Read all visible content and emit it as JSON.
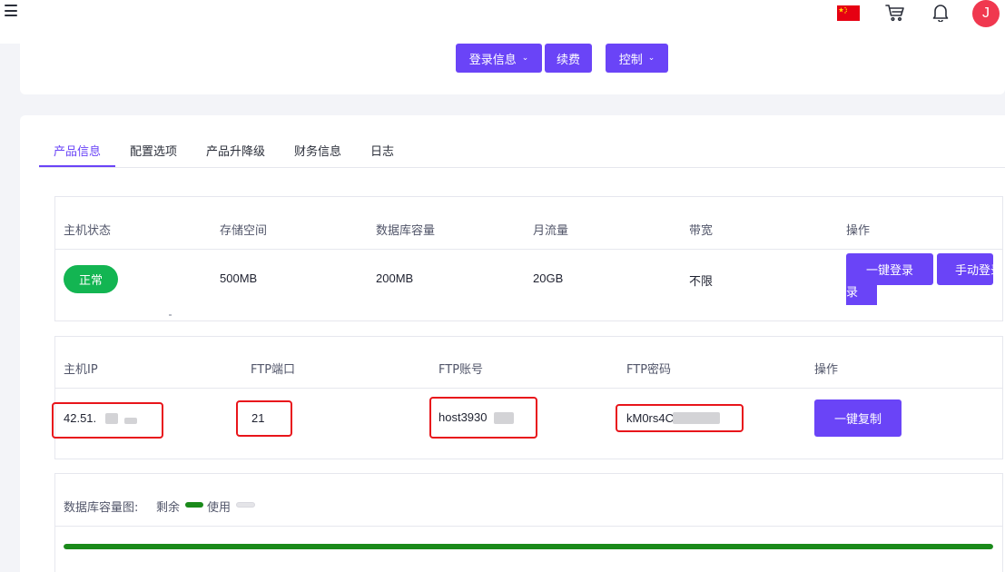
{
  "header": {
    "avatar_letter": "J",
    "icons": [
      "menu-icon",
      "china-flag-icon",
      "cart-icon",
      "bell-icon"
    ]
  },
  "actions": {
    "login_info": "登录信息",
    "renew": "续费",
    "control": "控制"
  },
  "tabs": [
    {
      "label": "产品信息",
      "active": true
    },
    {
      "label": "配置选项",
      "active": false
    },
    {
      "label": "产品升降级",
      "active": false
    },
    {
      "label": "财务信息",
      "active": false
    },
    {
      "label": "日志",
      "active": false
    }
  ],
  "host_table": {
    "headers": [
      "主机状态",
      "存储空间",
      "数据库容量",
      "月流量",
      "带宽",
      "操作"
    ],
    "row": {
      "status": "正常",
      "storage": "500MB",
      "database": "200MB",
      "traffic": "20GB",
      "bandwidth": "不限"
    },
    "btn_one_click_login": "一键登录",
    "btn_manual_login": "手动登录",
    "manual_login_wrap": "录"
  },
  "ftp_table": {
    "headers": [
      "主机IP",
      "FTP端口",
      "FTP账号",
      "FTP密码",
      "操作"
    ],
    "row": {
      "ip": "42.51.",
      "port": "21",
      "account": "host3930",
      "password": "kM0rs4C"
    },
    "btn_copy": "一键复制"
  },
  "db_usage": {
    "label": "数据库容量图:",
    "legend_remaining": "剩余",
    "legend_used": "使用",
    "remaining_fraction": 1.0
  },
  "colors": {
    "accent": "#6a44f7",
    "status_ok": "#13b552",
    "remaining": "#1a8a1a",
    "used": "#e4e4e8",
    "highlight": "#e8151b"
  }
}
